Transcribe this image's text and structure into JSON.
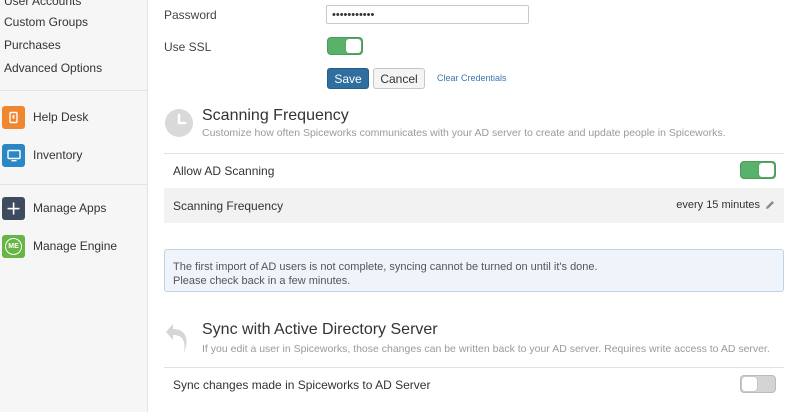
{
  "sidebar": {
    "links": [
      "User Accounts",
      "Custom Groups",
      "Purchases",
      "Advanced Options"
    ],
    "apps": [
      {
        "label": "Help Desk",
        "icon": "help-desk-icon",
        "color": "#f0862d"
      },
      {
        "label": "Inventory",
        "icon": "monitor-icon",
        "color": "#2b86c4"
      },
      {
        "label": "Manage Apps",
        "icon": "plus-icon",
        "color": "#3e4a5d"
      },
      {
        "label": "Manage Engine",
        "icon": "me-logo-icon",
        "icon_text": "ME",
        "color": "#66b545"
      }
    ]
  },
  "credentials": {
    "password_label": "Password",
    "password_value": "•••••••••••",
    "ssl_label": "Use SSL",
    "ssl_enabled": true,
    "save_label": "Save",
    "cancel_label": "Cancel",
    "clear_label": "Clear Credentials"
  },
  "scanning": {
    "title": "Scanning Frequency",
    "description": "Customize how often Spiceworks communicates with your AD server to create and update people in Spiceworks.",
    "allow_label": "Allow AD Scanning",
    "allow_enabled": true,
    "frequency_label": "Scanning Frequency",
    "frequency_value": "every 15 minutes"
  },
  "notice": {
    "line1": "The first import of AD users is not complete, syncing cannot be turned on until it's done.",
    "line2": "Please check back in a few minutes."
  },
  "sync": {
    "title": "Sync with Active Directory Server",
    "description": "If you edit a user in Spiceworks, those changes can be written back to your AD server. Requires write access to AD server.",
    "sync_label": "Sync changes made in Spiceworks to AD Server",
    "sync_enabled": false
  },
  "colors": {
    "primary_button": "#2f6e9f",
    "toggle_on": "#5ab26a",
    "toggle_off": "#d4d4d4",
    "link": "#3a76b0",
    "notice_bg": "#eef4fa"
  }
}
